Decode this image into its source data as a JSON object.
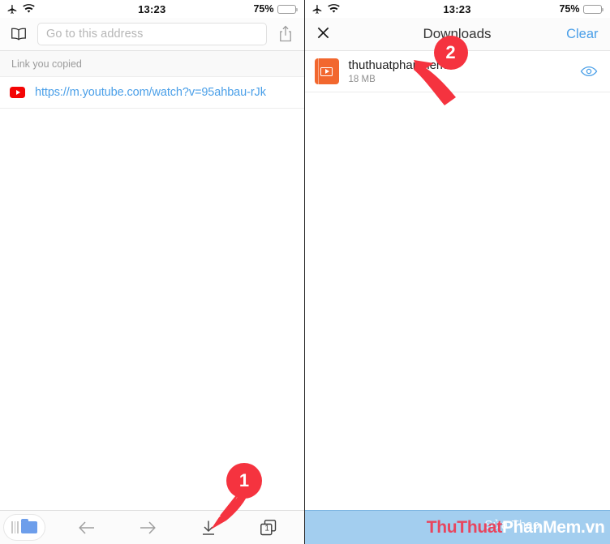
{
  "status_bar": {
    "airplane_icon": "airplane-mode-icon",
    "wifi_icon": "wifi-icon",
    "time": "13:23",
    "battery_percent": "75%",
    "battery_level": 75,
    "battery_color": "#f5c518"
  },
  "left_panel": {
    "name": "browser-screen",
    "address_bar": {
      "bookmarks_icon": "open-book-icon",
      "placeholder": "Go to this address",
      "value": "",
      "share_icon": "share-icon"
    },
    "copied_section": {
      "header": "Link you copied",
      "favicon": "youtube-icon",
      "url": "https://m.youtube.com/watch?v=95ahbau-rJk",
      "link_color": "#4a9fe8"
    },
    "toolbar": {
      "library_icon": "folder-library-icon",
      "back_icon": "arrow-left-icon",
      "forward_icon": "arrow-right-icon",
      "downloads_icon": "download-arrow-icon",
      "tabs_icon": "tabs-icon",
      "tab_count": "1"
    }
  },
  "right_panel": {
    "name": "downloads-screen",
    "header": {
      "close_icon": "close-x-icon",
      "title": "Downloads",
      "clear_label": "Clear",
      "clear_color": "#4a9fe8"
    },
    "downloads": [
      {
        "file_icon": "video-file-icon",
        "icon_color": "#f2672e",
        "name": "thuthuatphanmem",
        "size": "18 MB",
        "preview_icon": "eye-icon",
        "preview_color": "#4a9fe8"
      }
    ]
  },
  "annotations": [
    {
      "label": "1",
      "target": "downloads-toolbar-button",
      "color": "#f5333f"
    },
    {
      "label": "2",
      "target": "download-file-name",
      "color": "#f5333f"
    }
  ],
  "watermark": {
    "ghost_text": "Sửa Thao",
    "brand_red": "ThuThuat",
    "brand_white": "PhanMem.vn",
    "bar_color": "#a3ceef"
  }
}
